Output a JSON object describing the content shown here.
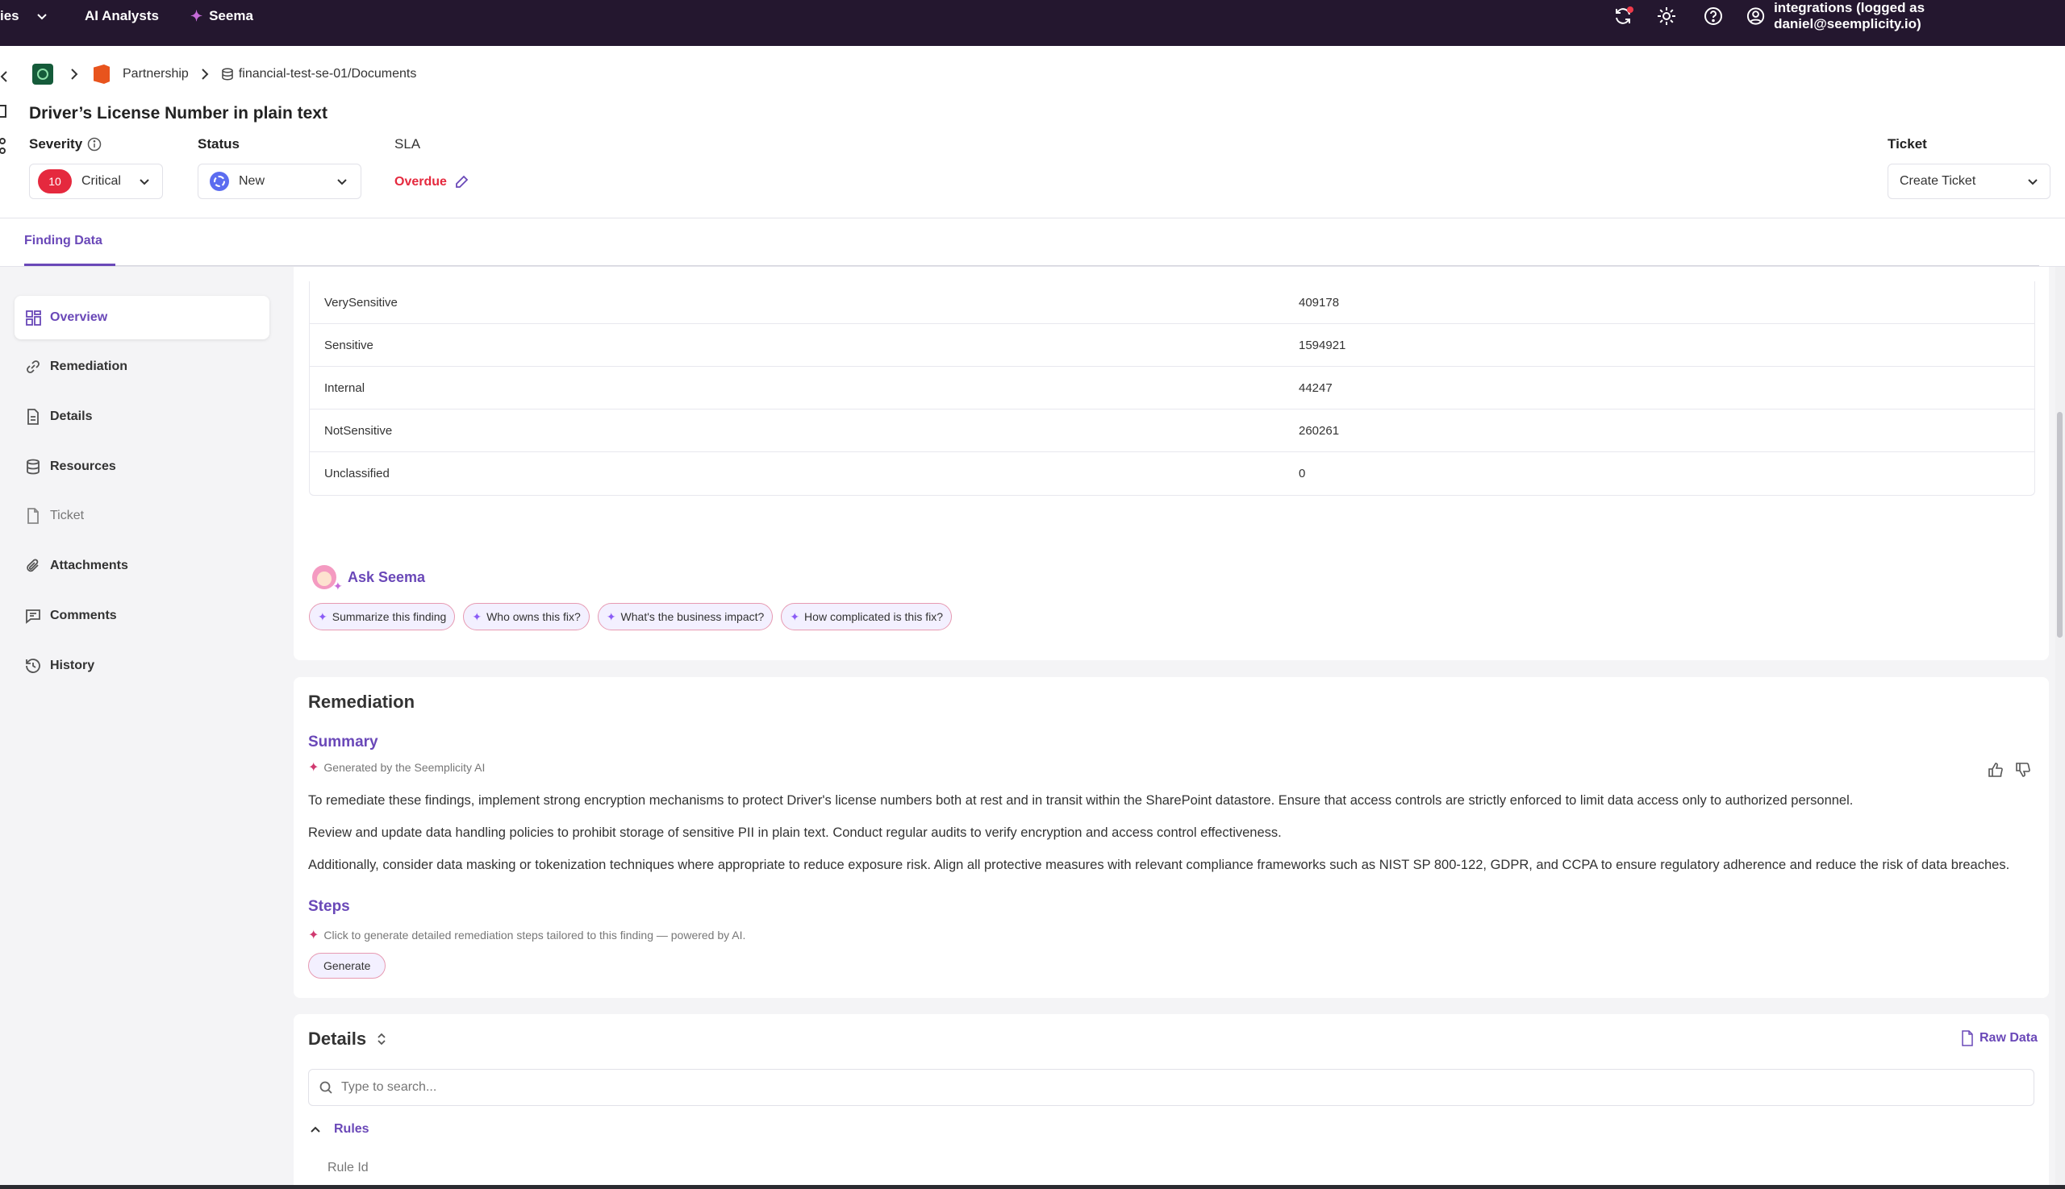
{
  "topbar": {
    "partial_menu_label": "ies",
    "ai_analysts_label": "AI Analysts",
    "seema_label": "Seema",
    "user_label": "integrations (logged as daniel@seemplicity.io)"
  },
  "breadcrumb": {
    "partnership": "Partnership",
    "path": "financial-test-se-01/Documents"
  },
  "finding": {
    "title": "Driver’s License Number in plain text",
    "severity_label": "Severity",
    "severity_score": "10",
    "severity_value": "Critical",
    "status_label": "Status",
    "status_value": "New",
    "sla_label": "SLA",
    "sla_value": "Overdue",
    "ticket_label": "Ticket",
    "ticket_value": "Create Ticket"
  },
  "tabs": [
    {
      "label": "Finding Data"
    }
  ],
  "sidebar": {
    "items": [
      {
        "label": "Overview",
        "icon": "grid-icon"
      },
      {
        "label": "Remediation",
        "icon": "link-icon"
      },
      {
        "label": "Details",
        "icon": "document-icon"
      },
      {
        "label": "Resources",
        "icon": "database-icon"
      },
      {
        "label": "Ticket",
        "icon": "ticket-icon"
      },
      {
        "label": "Attachments",
        "icon": "paperclip-icon"
      },
      {
        "label": "Comments",
        "icon": "comment-icon"
      },
      {
        "label": "History",
        "icon": "history-icon"
      }
    ]
  },
  "overview": {
    "rows": [
      {
        "name": "VerySensitive",
        "value": "409178"
      },
      {
        "name": "Sensitive",
        "value": "1594921"
      },
      {
        "name": "Internal",
        "value": "44247"
      },
      {
        "name": "NotSensitive",
        "value": "260261"
      },
      {
        "name": "Unclassified",
        "value": "0"
      }
    ],
    "ask_seema": "Ask Seema",
    "chips": [
      "Summarize this finding",
      "Who owns this fix?",
      "What's the business impact?",
      "How complicated is this fix?"
    ]
  },
  "remediation": {
    "title": "Remediation",
    "summary_title": "Summary",
    "generated_by": "Generated by the Seemplicity AI",
    "paragraphs": [
      "To remediate these findings, implement strong encryption mechanisms to protect Driver's license numbers both at rest and in transit within the SharePoint datastore. Ensure that access controls are strictly enforced to limit data access only to authorized personnel.",
      "Review and update data handling policies to prohibit storage of sensitive PII in plain text. Conduct regular audits to verify encryption and access control effectiveness.",
      "Additionally, consider data masking or tokenization techniques where appropriate to reduce exposure risk. Align all protective measures with relevant compliance frameworks such as NIST SP 800-122, GDPR, and CCPA to ensure regulatory adherence and reduce the risk of data breaches."
    ],
    "steps_title": "Steps",
    "steps_note": "Click to generate detailed remediation steps tailored to this finding — powered by AI.",
    "generate_label": "Generate"
  },
  "details": {
    "title": "Details",
    "raw_data_label": "Raw Data",
    "search_placeholder": "Type to search...",
    "rules_label": "Rules",
    "rule_id_label": "Rule Id"
  },
  "colors": {
    "topbar": "#24172f",
    "accent": "#6a48b8",
    "critical": "#e5293e",
    "overdue": "#e5293e",
    "status_new": "#5b6cf0"
  }
}
